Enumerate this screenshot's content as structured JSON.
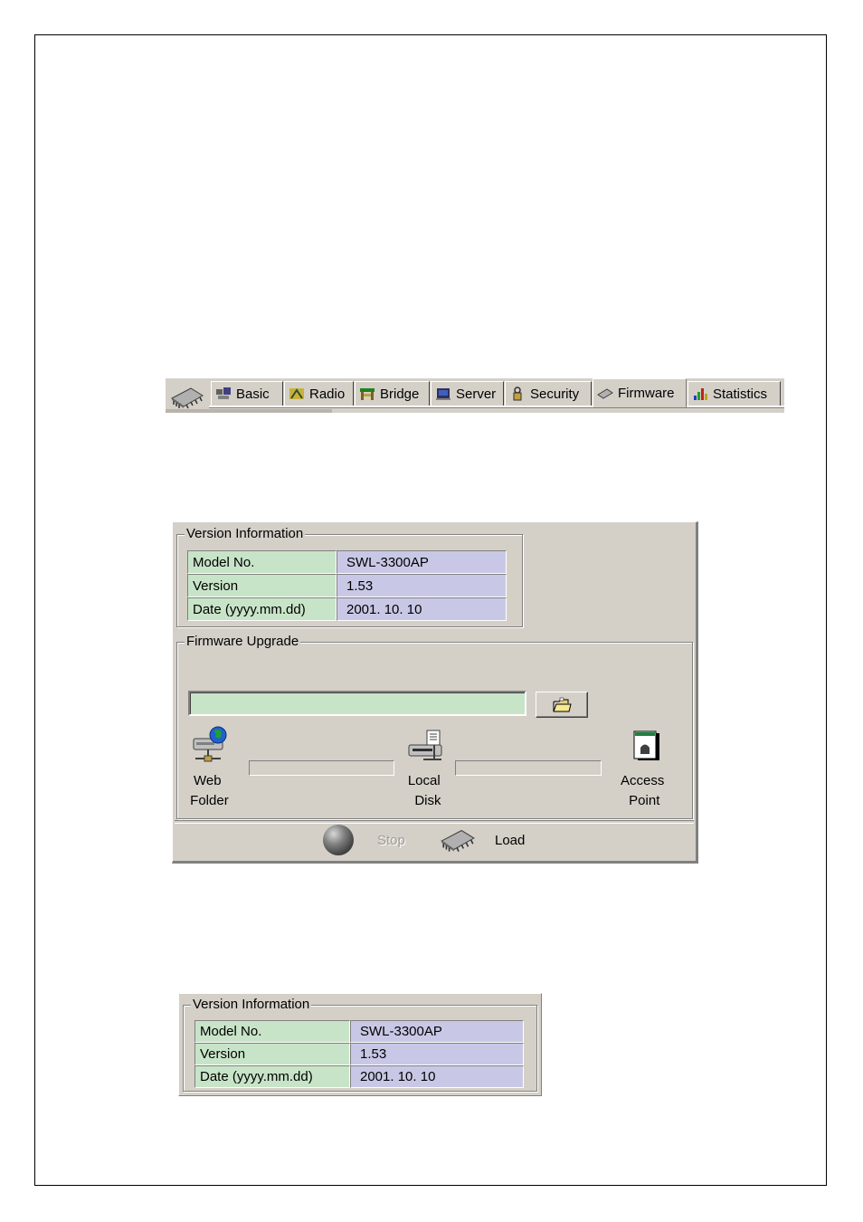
{
  "tabs": [
    {
      "label": "Basic",
      "icon": "basic-icon"
    },
    {
      "label": "Radio",
      "icon": "radio-icon"
    },
    {
      "label": "Bridge",
      "icon": "bridge-icon"
    },
    {
      "label": "Server",
      "icon": "server-icon"
    },
    {
      "label": "Security",
      "icon": "security-icon"
    },
    {
      "label": "Firmware",
      "icon": "firmware-icon",
      "active": true
    },
    {
      "label": "Statistics",
      "icon": "statistics-icon"
    }
  ],
  "version_info": {
    "title": "Version Information",
    "rows": [
      {
        "label": "Model No.",
        "value": "SWL-3300AP"
      },
      {
        "label": "Version",
        "value": "1.53"
      },
      {
        "label": "Date (yyyy.mm.dd)",
        "value": "2001. 10. 10"
      }
    ]
  },
  "firmware_upgrade": {
    "title": "Firmware Upgrade",
    "file_path": "",
    "nodes": {
      "web_folder": "Web\n Folder",
      "local_disk": "Local\n  Disk",
      "access_point": "Access\n Point"
    },
    "progress": {
      "web_to_local": 0,
      "local_to_ap": 0
    }
  },
  "actions": {
    "stop": "Stop",
    "load": "Load"
  },
  "colors": {
    "field_green": "#c8e4c8",
    "field_purple": "#c8c8e6",
    "panel_gray": "#d4d0c8"
  }
}
